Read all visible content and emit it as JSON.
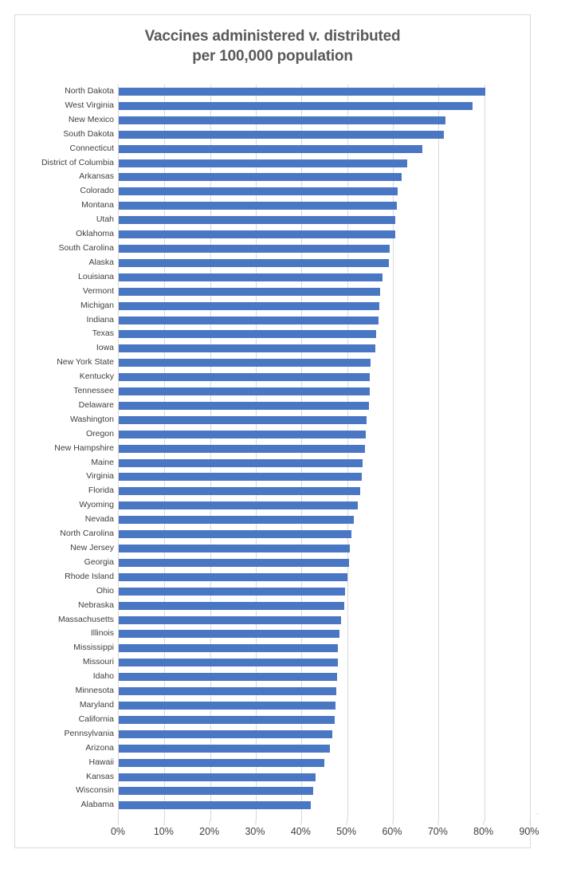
{
  "chart_data": {
    "type": "bar",
    "orientation": "horizontal",
    "title": "Vaccines administered v. distributed per 100,000 population",
    "title_lines": [
      "Vaccines administered v. distributed",
      "per 100,000 population"
    ],
    "xlabel": "",
    "ylabel": "",
    "xlim": [
      0,
      90
    ],
    "x_tick_labels": [
      "0%",
      "10%",
      "20%",
      "30%",
      "40%",
      "50%",
      "60%",
      "70%",
      "80%",
      "90%"
    ],
    "x_tick_values": [
      0,
      10,
      20,
      30,
      40,
      50,
      60,
      70,
      80,
      90
    ],
    "grid": true,
    "legend": "none",
    "bar_color": "#4a77c4",
    "categories": [
      "North Dakota",
      "West Virginia",
      "New Mexico",
      "South Dakota",
      "Connecticut",
      "District of Columbia",
      "Arkansas",
      "Colorado",
      "Montana",
      "Utah",
      "Oklahoma",
      "South Carolina",
      "Alaska",
      "Louisiana",
      "Vermont",
      "Michigan",
      "Indiana",
      "Texas",
      "Iowa",
      "New York State",
      "Kentucky",
      "Tennessee",
      "Delaware",
      "Washington",
      "Oregon",
      "New Hampshire",
      "Maine",
      "Virginia",
      "Florida",
      "Wyoming",
      "Nevada",
      "North Carolina",
      "New Jersey",
      "Georgia",
      "Rhode Island",
      "Ohio",
      "Nebraska",
      "Massachusetts",
      "Illinois",
      "Mississippi",
      "Missouri",
      "Idaho",
      "Minnesota",
      "Maryland",
      "California",
      "Pennsylvania",
      "Arizona",
      "Hawaii",
      "Kansas",
      "Wisconsin",
      "Alabama"
    ],
    "values": [
      80.3,
      77.5,
      71.5,
      71.1,
      66.4,
      63.2,
      62.0,
      61.0,
      60.8,
      60.6,
      60.5,
      59.3,
      59.2,
      57.7,
      57.2,
      57.0,
      56.8,
      56.3,
      56.1,
      55.2,
      55.0,
      54.9,
      54.7,
      54.2,
      54.0,
      53.9,
      53.3,
      53.2,
      52.8,
      52.3,
      51.5,
      50.9,
      50.6,
      50.4,
      50.0,
      49.5,
      49.3,
      48.6,
      48.4,
      48.0,
      47.9,
      47.8,
      47.6,
      47.4,
      47.3,
      46.8,
      46.3,
      45.0,
      43.0,
      42.5,
      42.1
    ],
    "units": "percent"
  },
  "footer": {
    "edge_artifact": ".."
  }
}
